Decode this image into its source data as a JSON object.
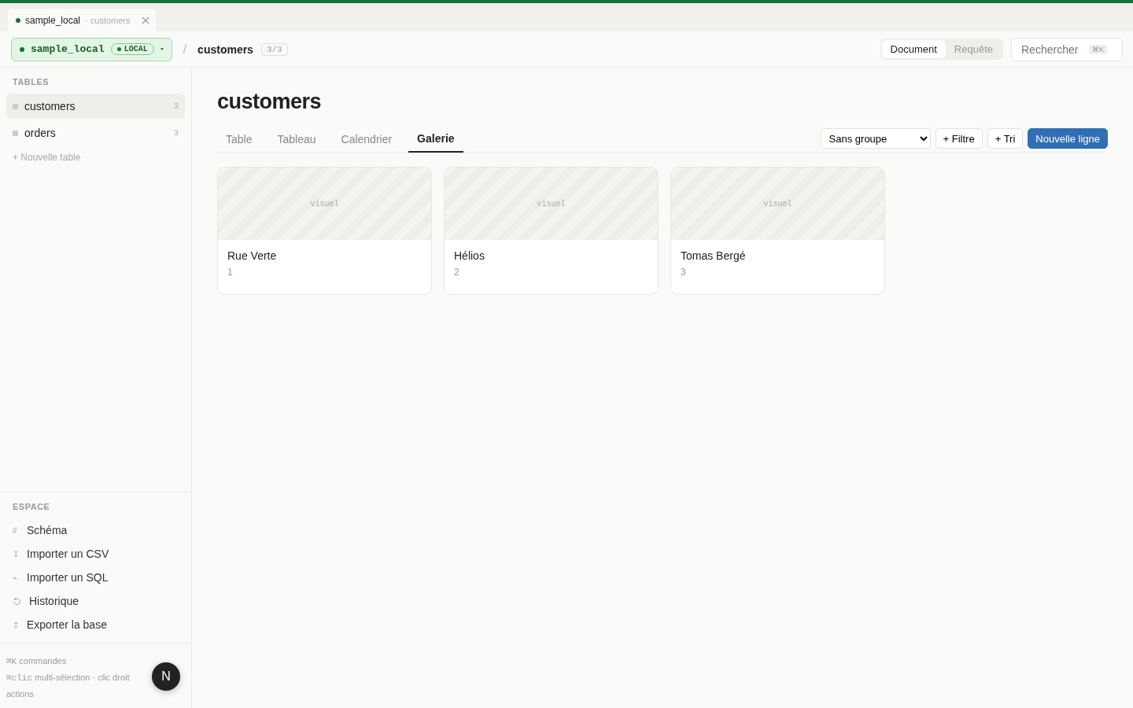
{
  "window_tab": {
    "title": "sample_local",
    "subtitle": "· customers"
  },
  "header": {
    "database": "sample_local",
    "badge": "LOCAL",
    "separator": "/",
    "crumb": "customers",
    "count": "3/3",
    "modes": [
      {
        "label": "Document",
        "selected": true
      },
      {
        "label": "Requête",
        "selected": false
      }
    ],
    "search": {
      "placeholder": "Rechercher",
      "shortcut": "⌘K"
    }
  },
  "sidebar": {
    "tables_heading": "TABLES",
    "tables": [
      {
        "name": "customers",
        "count": "3",
        "selected": true
      },
      {
        "name": "orders",
        "count": "3",
        "selected": false
      }
    ],
    "new_table": "+ Nouvelle table",
    "space_heading": "ESPACE",
    "space_items": [
      {
        "kind": "glyph",
        "icon": "#",
        "label": "Schéma"
      },
      {
        "kind": "glyph",
        "icon": "↧",
        "label": "Importer un CSV"
      },
      {
        "kind": "glyph",
        "icon": "⌁",
        "label": "Importer un SQL"
      },
      {
        "kind": "history",
        "label": "Historique"
      },
      {
        "kind": "glyph",
        "icon": "↥",
        "label": "Exporter la base"
      }
    ],
    "hints": [
      {
        "keys": "⌘K",
        "text": "commandes"
      },
      {
        "keys": "⌘clic",
        "text": "multi-sélection · clic droit actions"
      }
    ]
  },
  "main": {
    "title": "customers",
    "views": [
      {
        "label": "Table",
        "selected": false
      },
      {
        "label": "Tableau",
        "selected": false
      },
      {
        "label": "Calendrier",
        "selected": false
      },
      {
        "label": "Galerie",
        "selected": true
      }
    ],
    "group_select": "Sans groupe",
    "filter": "+ Filtre",
    "sort": "+ Tri",
    "new_row": "Nouvelle ligne",
    "cards": [
      {
        "image_label": "visuel",
        "title": "Rue Verte",
        "id": "1"
      },
      {
        "image_label": "visuel",
        "title": "Hélios",
        "id": "2"
      },
      {
        "image_label": "visuel",
        "title": "Tomas Bergé",
        "id": "3"
      }
    ]
  },
  "avatar": {
    "initial": "N"
  }
}
